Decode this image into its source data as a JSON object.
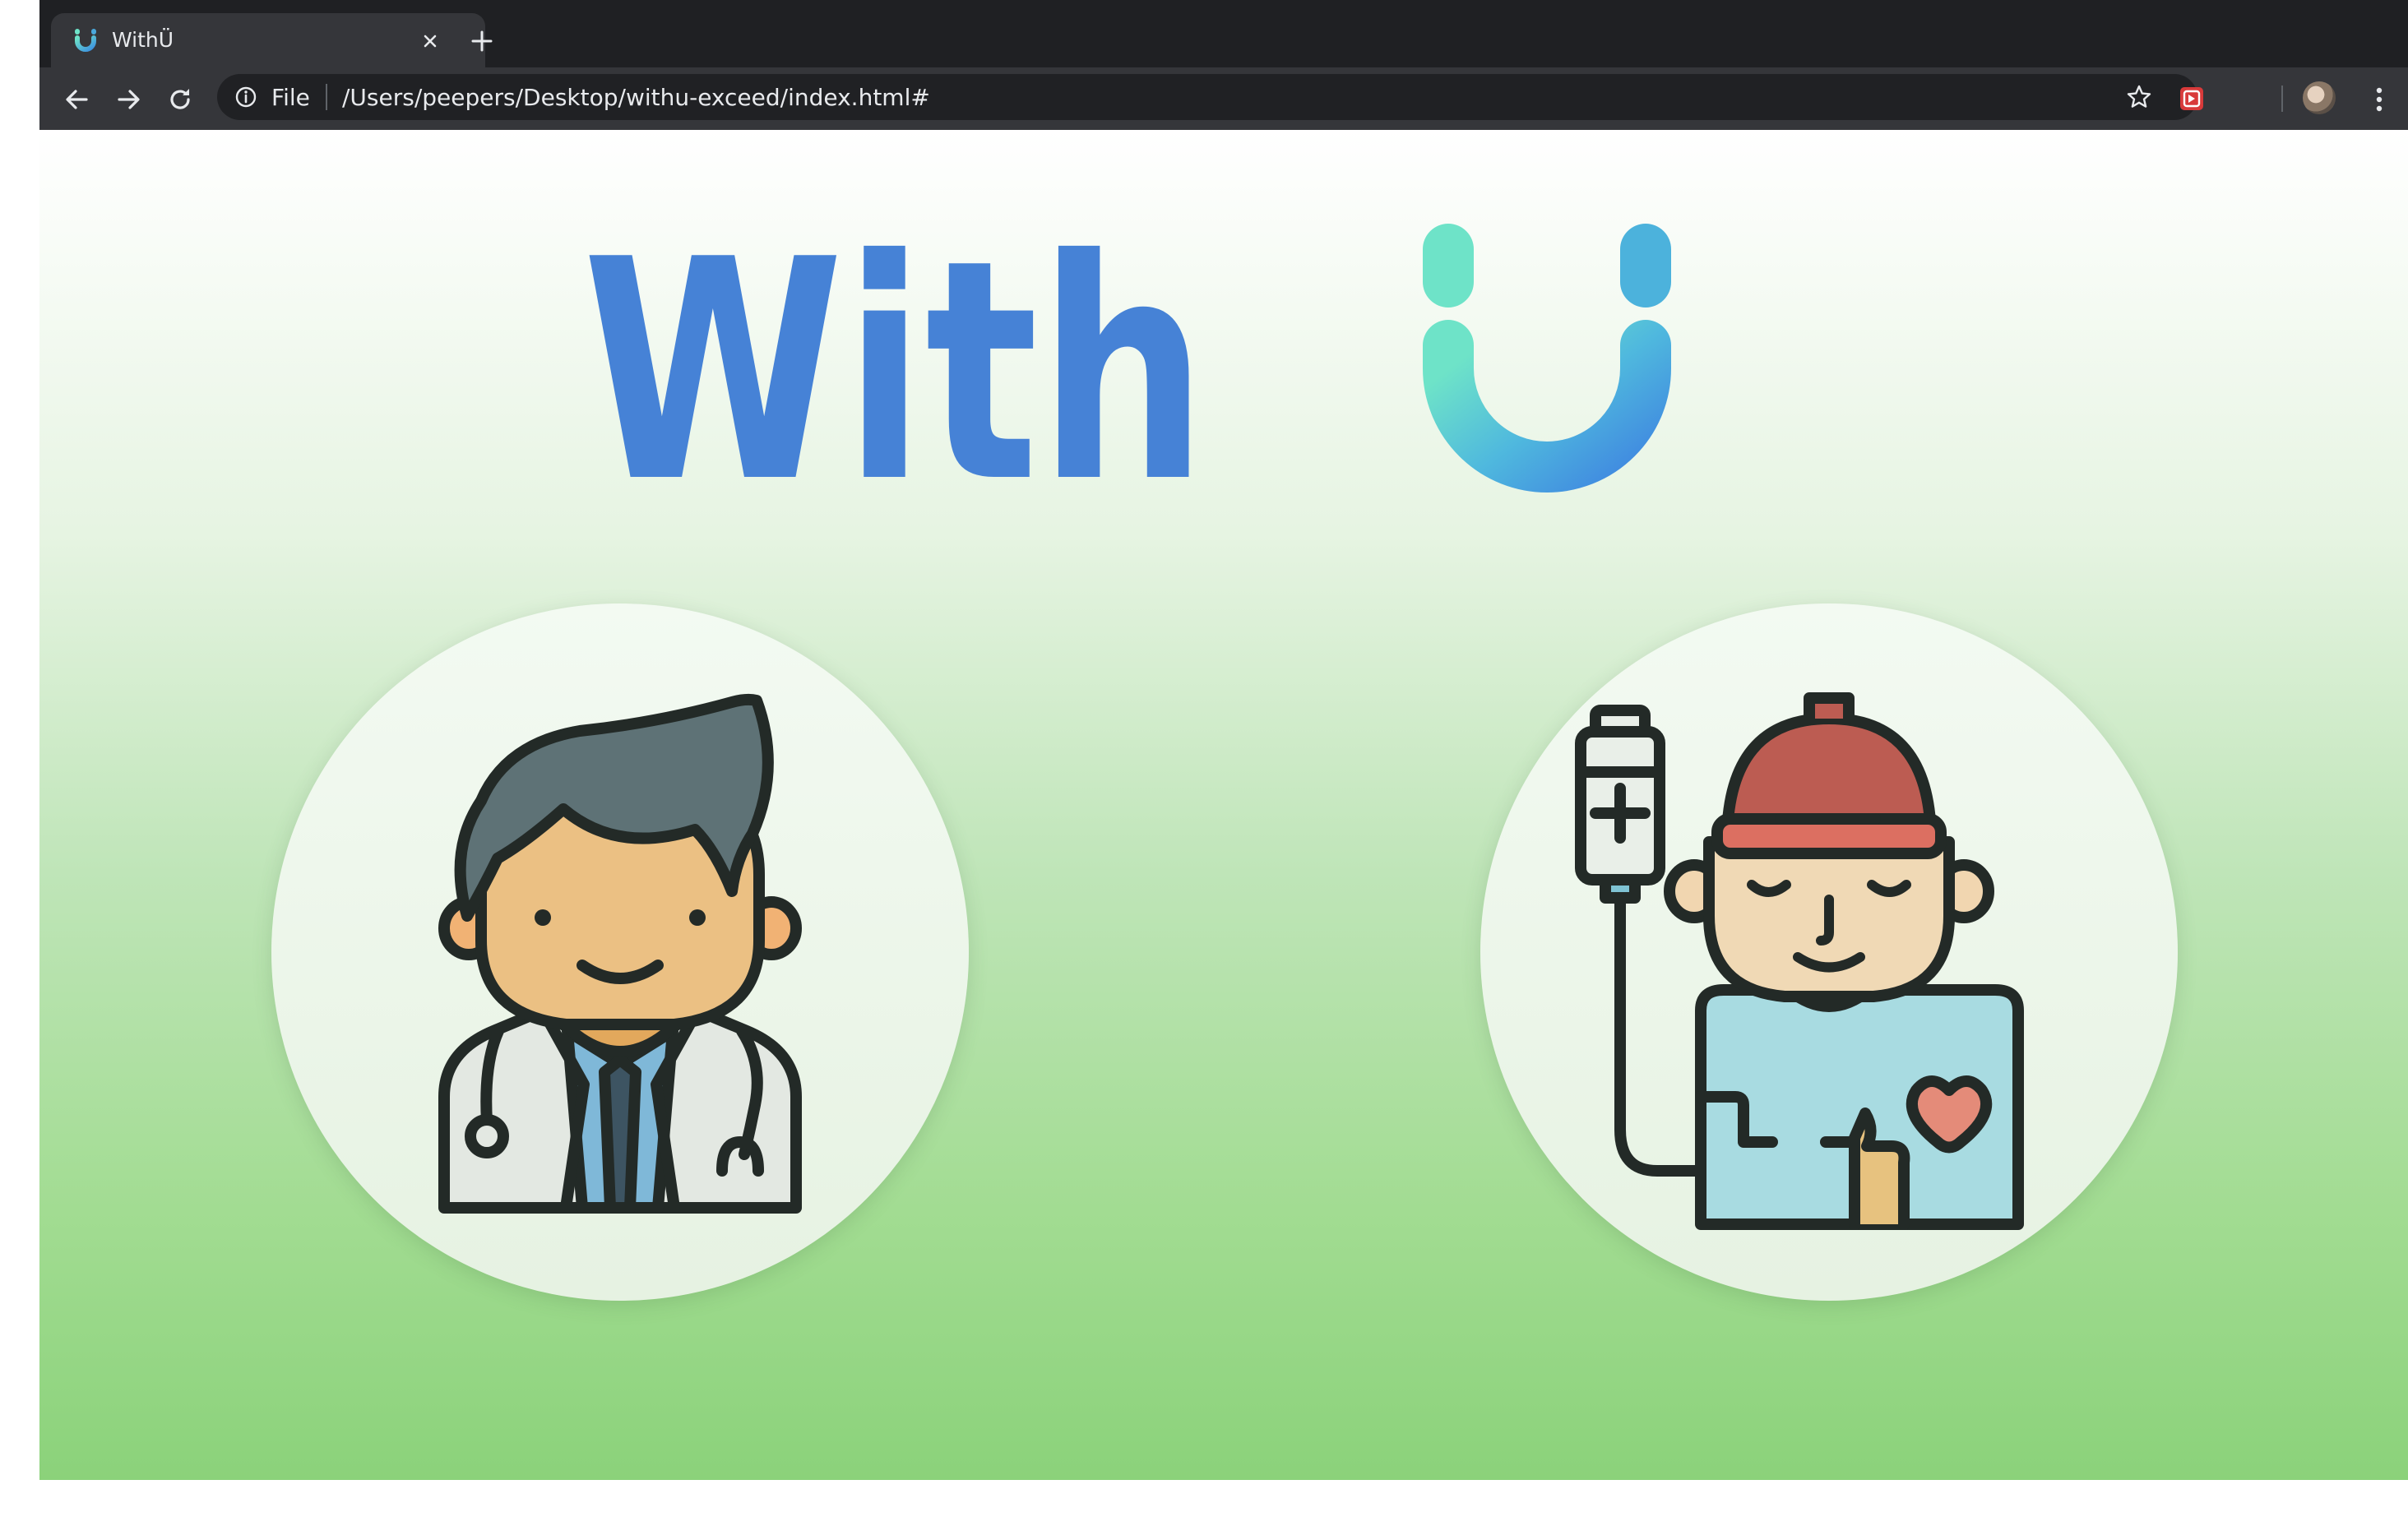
{
  "browser": {
    "tab_title": "WithÜ",
    "url_scheme_label": "File",
    "url": "/Users/peepers/Desktop/withu-exceed/index.html#"
  },
  "icons": {
    "tab_close": "close-icon",
    "new_tab": "plus-icon",
    "back": "arrow-left-icon",
    "forward": "arrow-right-icon",
    "reload": "reload-icon",
    "site_info": "info-icon",
    "bookmark": "star-icon",
    "extension": "extension-icon",
    "menu": "kebab-menu-icon"
  },
  "page": {
    "logo_text": "With",
    "logo_mark": "U",
    "cards": [
      {
        "role": "doctor"
      },
      {
        "role": "patient"
      }
    ]
  },
  "colors": {
    "logo_blue": "#4682d6",
    "logo_teal": "#6ee3c8",
    "background_green": "#8bd27a",
    "chrome_dark": "#1f2023"
  }
}
